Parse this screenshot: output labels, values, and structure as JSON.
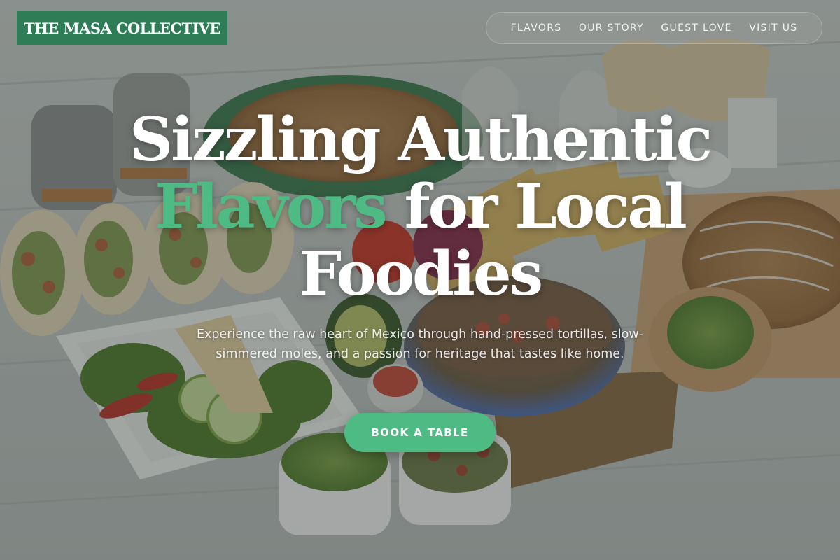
{
  "brand": {
    "logo_text": "THE MASA COLLECTIVE"
  },
  "nav": {
    "items": [
      {
        "label": "FLAVORS"
      },
      {
        "label": "OUR STORY"
      },
      {
        "label": "GUEST LOVE"
      },
      {
        "label": "VISIT US"
      }
    ]
  },
  "hero": {
    "headline_part1": "Sizzling Authentic",
    "headline_accent": "Flavors",
    "headline_part2": "for Local",
    "headline_part3": "Foodies",
    "subtitle": "Experience the raw heart of Mexico through hand-pressed tortillas, slow-simmered moles, and a passion for heritage that tastes like home.",
    "cta_label": "BOOK A TABLE"
  },
  "colors": {
    "brand_green": "#2f7d57",
    "accent_green": "#4fbb84",
    "text_white": "#ffffff"
  }
}
